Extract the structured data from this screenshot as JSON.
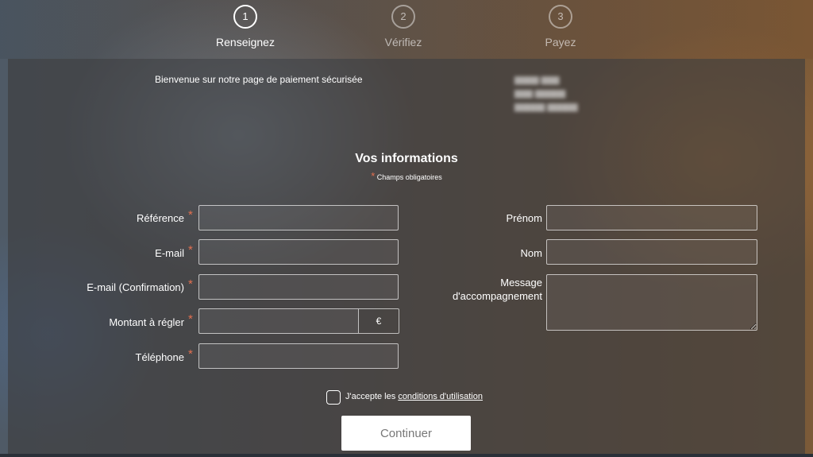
{
  "steps": [
    {
      "number": "1",
      "label": "Renseignez",
      "active": true
    },
    {
      "number": "2",
      "label": "Vérifiez",
      "active": false
    },
    {
      "number": "3",
      "label": "Payez",
      "active": false
    }
  ],
  "header": {
    "welcome": "Bienvenue sur notre page de paiement sécurisée"
  },
  "form": {
    "title": "Vos informations",
    "required_star": "*",
    "required_note": "Champs obligatoires",
    "left_fields": {
      "reference": {
        "label": "Référence",
        "value": ""
      },
      "email": {
        "label": "E-mail",
        "value": ""
      },
      "email_confirm": {
        "label": "E-mail (Confirmation)",
        "value": ""
      },
      "amount": {
        "label": "Montant à régler",
        "value": "",
        "currency": "€"
      },
      "phone": {
        "label": "Téléphone",
        "value": ""
      }
    },
    "right_fields": {
      "firstname": {
        "label": "Prénom",
        "value": ""
      },
      "lastname": {
        "label": "Nom",
        "value": ""
      },
      "message": {
        "label_line1": "Message",
        "label_line2": "d'accompagnement",
        "value": ""
      }
    },
    "terms": {
      "prefix": "J'accepte les",
      "link": "conditions d'utilisation",
      "checked": false
    },
    "continue_label": "Continuer"
  },
  "colors": {
    "required": "#e27050",
    "button_bg": "#ffffff",
    "button_text": "#777777"
  }
}
